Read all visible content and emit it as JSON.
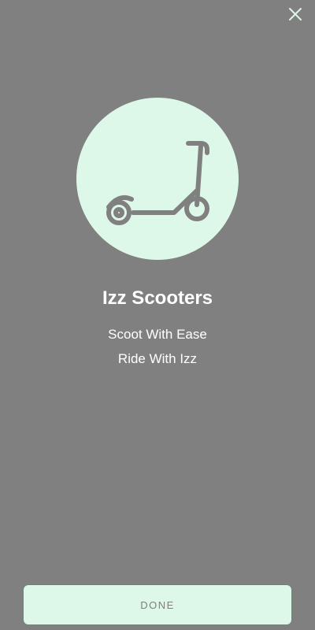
{
  "header": {
    "close_icon": "close-icon"
  },
  "hero": {
    "icon": "scooter-icon",
    "circle_color": "#ddf8e8",
    "icon_color": "#808080"
  },
  "content": {
    "title": "Izz Scooters",
    "lines": [
      "Scoot With Ease",
      "Ride With Izz"
    ]
  },
  "footer": {
    "done_label": "DONE"
  },
  "colors": {
    "background": "#808080",
    "accent": "#ddf8e8",
    "text": "#ffffff",
    "button_text": "#7f7f7f"
  }
}
